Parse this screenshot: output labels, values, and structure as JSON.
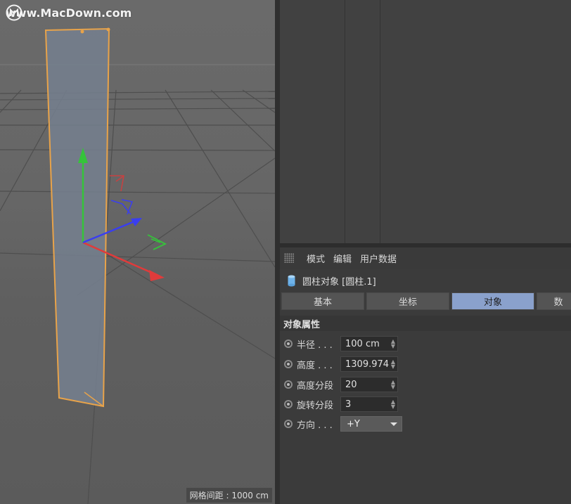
{
  "watermark": {
    "text": "www.MacDown.com"
  },
  "viewport": {
    "grid_spacing_label": "网格间距 : 1000 cm"
  },
  "attribute_manager": {
    "menu": [
      "模式",
      "编辑",
      "用户数据"
    ],
    "object_title": "圆柱对象 [圆柱.1]",
    "tabs": [
      {
        "label": "基本",
        "active": false
      },
      {
        "label": "坐标",
        "active": false
      },
      {
        "label": "对象",
        "active": true
      },
      {
        "label": "数",
        "active": false
      }
    ],
    "section_title": "对象属性",
    "params": [
      {
        "label": "半径 . . .",
        "value": "100 cm",
        "type": "stepper"
      },
      {
        "label": "高度 . . .",
        "value": "1309.974",
        "type": "stepper"
      },
      {
        "label": "高度分段",
        "value": "20",
        "type": "stepper"
      },
      {
        "label": "旋转分段",
        "value": "3",
        "type": "stepper"
      },
      {
        "label": "方向 . . .",
        "value": "+Y",
        "type": "dropdown"
      }
    ]
  },
  "colors": {
    "accent_tab": "#8aa1cc",
    "selection_outline": "#e8a34a"
  }
}
